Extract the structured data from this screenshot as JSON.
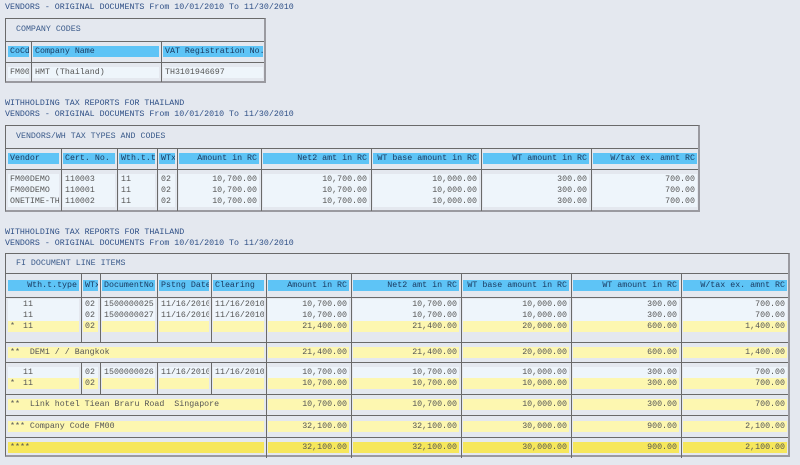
{
  "header_lines": {
    "period_1": "VENDORS - ORIGINAL DOCUMENTS From 10/01/2010 To 11/30/2010",
    "report_title_2": "WITHHOLDING TAX REPORTS FOR THAILAND",
    "period_2": "VENDORS - ORIGINAL DOCUMENTS From 10/01/2010 To 11/30/2010",
    "report_title_3": "WITHHOLDING TAX REPORTS FOR THAILAND",
    "period_3": "VENDORS - ORIGINAL DOCUMENTS From 10/01/2010 To 11/30/2010"
  },
  "colors": {
    "header_field": "#5ec4f6",
    "subtotal": "#fdf7b0",
    "total": "#f6e75c",
    "row": "#eef5fb",
    "background": "#e4e8ef"
  },
  "company_codes": {
    "title": "COMPANY CODES",
    "columns": [
      "CoCd",
      "Company Name",
      "VAT Registration No."
    ],
    "blocks": [
      {
        "type": "detail",
        "rows": [
          {
            "style": "normal",
            "cells": [
              "FM00",
              "HMT (Thailand)",
              "TH3101946697"
            ]
          }
        ]
      }
    ]
  },
  "vendors_wh": {
    "title": "VENDORS/WH TAX TYPES AND CODES",
    "columns": [
      "Vendor",
      "Cert. No.",
      "Wth.t.t",
      "WTx",
      "Amount in RC",
      "Net2 amt in RC",
      "WT base amount in RC",
      "WT amount in RC",
      "W/tax ex. amnt RC"
    ],
    "blocks": [
      {
        "type": "detail",
        "rows": [
          {
            "style": "normal",
            "cells": [
              "FM00DEMO",
              "110003",
              "11",
              "02",
              "10,700.00",
              "10,700.00",
              "10,000.00",
              "300.00",
              "700.00"
            ]
          },
          {
            "style": "normal",
            "cells": [
              "FM00DEMO",
              "110001",
              "11",
              "02",
              "10,700.00",
              "10,700.00",
              "10,000.00",
              "300.00",
              "700.00"
            ]
          },
          {
            "style": "normal",
            "cells": [
              "ONETIME-TH",
              "110002",
              "11",
              "02",
              "10,700.00",
              "10,700.00",
              "10,000.00",
              "300.00",
              "700.00"
            ]
          }
        ]
      }
    ]
  },
  "fi_items": {
    "title": "FI DOCUMENT LINE ITEMS",
    "columns": [
      "Wth.t.type",
      "WTx",
      "DocumentNo",
      "Pstng Date",
      "Clearing",
      "Amount in RC",
      "Net2 amt in RC",
      "WT base amount in RC",
      "WT amount in RC",
      "W/tax ex. amnt RC"
    ],
    "blocks": [
      {
        "type": "detail",
        "rows": [
          {
            "style": "normal",
            "cells": [
              "11",
              "02",
              "1500000025",
              "11/16/2010",
              "11/16/2010",
              "10,700.00",
              "10,700.00",
              "10,000.00",
              "300.00",
              "700.00"
            ]
          },
          {
            "style": "normal",
            "cells": [
              "11",
              "02",
              "1500000027",
              "11/16/2010",
              "11/16/2010",
              "10,700.00",
              "10,700.00",
              "10,000.00",
              "300.00",
              "700.00"
            ]
          },
          {
            "style": "subtotal",
            "marker": "*",
            "cells": [
              "11",
              "02",
              "",
              "",
              "",
              "21,400.00",
              "21,400.00",
              "20,000.00",
              "600.00",
              "1,400.00"
            ]
          }
        ]
      },
      {
        "type": "summary",
        "style": "subtotal",
        "label": "**  DEM1 / / Bangkok",
        "values": [
          "21,400.00",
          "21,400.00",
          "20,000.00",
          "600.00",
          "1,400.00"
        ]
      },
      {
        "type": "detail",
        "rows": [
          {
            "style": "normal",
            "cells": [
              "11",
              "02",
              "1500000026",
              "11/16/2010",
              "11/16/2010",
              "10,700.00",
              "10,700.00",
              "10,000.00",
              "300.00",
              "700.00"
            ]
          },
          {
            "style": "subtotal",
            "marker": "*",
            "cells": [
              "11",
              "02",
              "",
              "",
              "",
              "10,700.00",
              "10,700.00",
              "10,000.00",
              "300.00",
              "700.00"
            ]
          }
        ]
      },
      {
        "type": "summary",
        "style": "subtotal",
        "label": "**  Link hotel Tiean Braru Road  Singapore",
        "values": [
          "10,700.00",
          "10,700.00",
          "10,000.00",
          "300.00",
          "700.00"
        ]
      },
      {
        "type": "summary",
        "style": "subtotal",
        "label": "*** Company Code FM00",
        "values": [
          "32,100.00",
          "32,100.00",
          "30,000.00",
          "900.00",
          "2,100.00"
        ]
      },
      {
        "type": "summary",
        "style": "total",
        "label": "****",
        "values": [
          "32,100.00",
          "32,100.00",
          "30,000.00",
          "900.00",
          "2,100.00"
        ]
      }
    ]
  }
}
